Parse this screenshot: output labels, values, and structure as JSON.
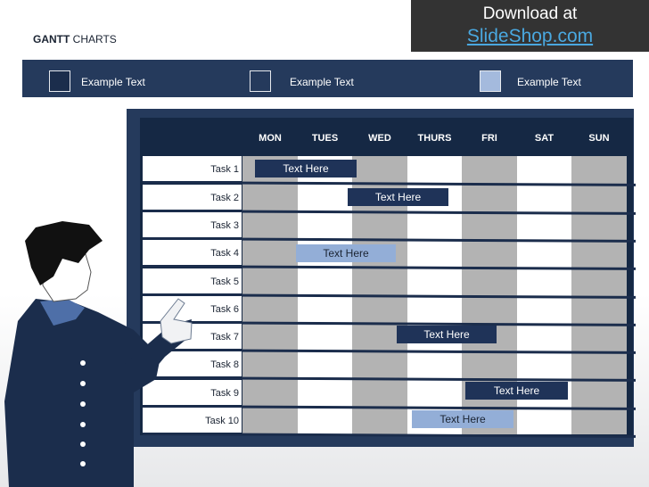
{
  "header": {
    "title_bold": "GANTT",
    "title_rest": "CHARTS"
  },
  "download": {
    "line1": "Download at",
    "line2": "SlideShop.com"
  },
  "legend": [
    {
      "label": "Example Text",
      "color": "#1b2d4c"
    },
    {
      "label": "Example Text",
      "color": "#253a5c"
    },
    {
      "label": "Example Text",
      "color": "#a4badd"
    }
  ],
  "days": [
    "MON",
    "TUES",
    "WED",
    "THURS",
    "FRI",
    "SAT",
    "SUN"
  ],
  "tasks": [
    "Task 1",
    "Task 2",
    "Task 3",
    "Task 4",
    "Task 5",
    "Task 6",
    "Task 7",
    "Task 8",
    "Task 9",
    "Task 10"
  ],
  "bars": [
    {
      "label": "Text Here",
      "task": "Task 1",
      "style": "dark"
    },
    {
      "label": "Text Here",
      "task": "Task 2",
      "style": "dark"
    },
    {
      "label": "Text Here",
      "task": "Task 4",
      "style": "light"
    },
    {
      "label": "Text Here",
      "task": "Task 7",
      "style": "dark"
    },
    {
      "label": "Text Here",
      "task": "Task 9",
      "style": "dark"
    },
    {
      "label": "Text Here",
      "task": "Task 10",
      "style": "light"
    }
  ]
}
